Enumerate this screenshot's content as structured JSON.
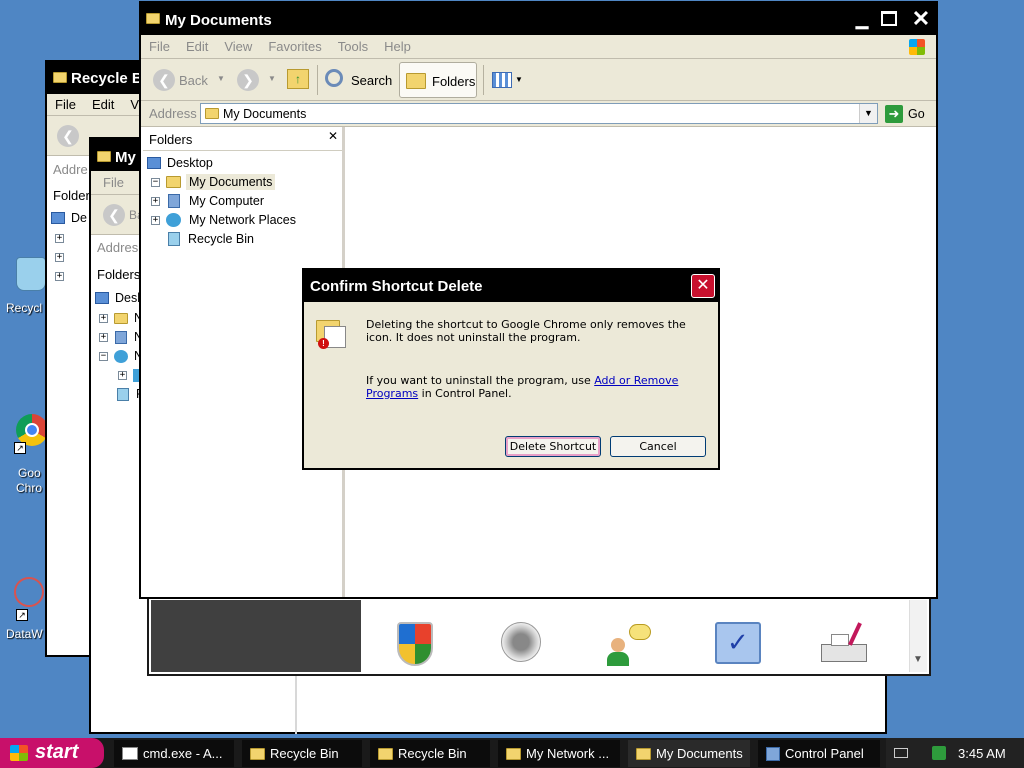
{
  "desktop": {
    "icons": [
      {
        "label": "Recycl",
        "name": "recycle"
      },
      {
        "label": "Goo",
        "label2": "Chro",
        "name": "chrome"
      },
      {
        "label": "DataW",
        "name": "dataw"
      }
    ]
  },
  "recycle_win": {
    "title": "Recycle B",
    "menu": [
      "File",
      "Edit",
      "V"
    ],
    "back": "Back",
    "address": "Addre",
    "folders": "Folder",
    "tree_first": "De"
  },
  "mycomp_win": {
    "title": "My",
    "menu": [
      "File"
    ],
    "back": "Ba",
    "address": "Addres",
    "folders": "Folders",
    "tree_first": "Desk",
    "tree": [
      "N",
      "N",
      "N",
      "F"
    ]
  },
  "my_documents": {
    "title": "My Documents",
    "menu": [
      "File",
      "Edit",
      "View",
      "Favorites",
      "Tools",
      "Help"
    ],
    "toolbar": {
      "back": "Back",
      "search": "Search",
      "folders": "Folders"
    },
    "address_label": "Address",
    "address_value": "My Documents",
    "go": "Go",
    "folders_pane_title": "Folders",
    "tree": [
      {
        "label": "Desktop"
      },
      {
        "label": "My Documents"
      },
      {
        "label": "My Computer"
      },
      {
        "label": "My Network Places"
      },
      {
        "label": "Recycle Bin"
      }
    ]
  },
  "dialog": {
    "title": "Confirm Shortcut Delete",
    "line1": "Deleting the shortcut to Google Chrome only removes the icon. It does not uninstall the program.",
    "line2_pre": "If you want to uninstall the program, use ",
    "line2_link": "Add or Remove Programs",
    "line2_post": " in Control Panel.",
    "primary": "Delete Shortcut",
    "secondary": "Cancel"
  },
  "control_panel_icons": [
    "security-center-icon",
    "sounds-icon",
    "user-accounts-icon",
    "system-icon",
    "printers-icon"
  ],
  "taskbar": {
    "start": "start",
    "items": [
      "cmd.exe - A...",
      "Recycle Bin",
      "Recycle Bin",
      "My Network ...",
      "My Documents",
      "Control Panel"
    ],
    "clock": "3:45 AM"
  },
  "colors": {
    "desktop": "#4f86c4",
    "titlebar": "#000000",
    "close": "#c8102e",
    "start": "#c8106a"
  }
}
